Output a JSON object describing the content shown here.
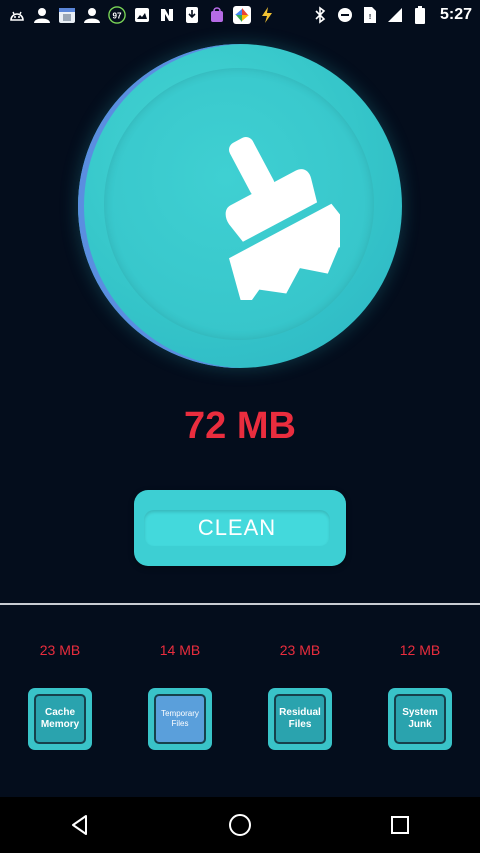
{
  "status_bar": {
    "time": "5:27",
    "notification_badge": "97",
    "icons_left": [
      "android-icon",
      "person-icon",
      "calendar-icon",
      "person-icon",
      "badge-icon",
      "image-icon",
      "n-icon",
      "download-icon",
      "bag-icon",
      "photos-icon",
      "bolt-icon"
    ],
    "icons_right": [
      "bluetooth-icon",
      "do-not-disturb-icon",
      "sim-icon",
      "signal-icon",
      "battery-icon"
    ]
  },
  "cleaner": {
    "total_size": "72 MB",
    "clean_label": "CLEAN"
  },
  "categories": [
    {
      "size": "23 MB",
      "label": "Cache Memory",
      "icon": "cache-memory-icon"
    },
    {
      "size": "14 MB",
      "label": "Temporary Files",
      "icon": "temporary-files-icon"
    },
    {
      "size": "23 MB",
      "label": "Residual Files",
      "icon": "residual-files-icon"
    },
    {
      "size": "12 MB",
      "label": "System Junk",
      "icon": "system-junk-icon"
    }
  ],
  "colors": {
    "background": "#040d1c",
    "accent": "#3dcfd3",
    "size_red": "#ea2d3e"
  }
}
